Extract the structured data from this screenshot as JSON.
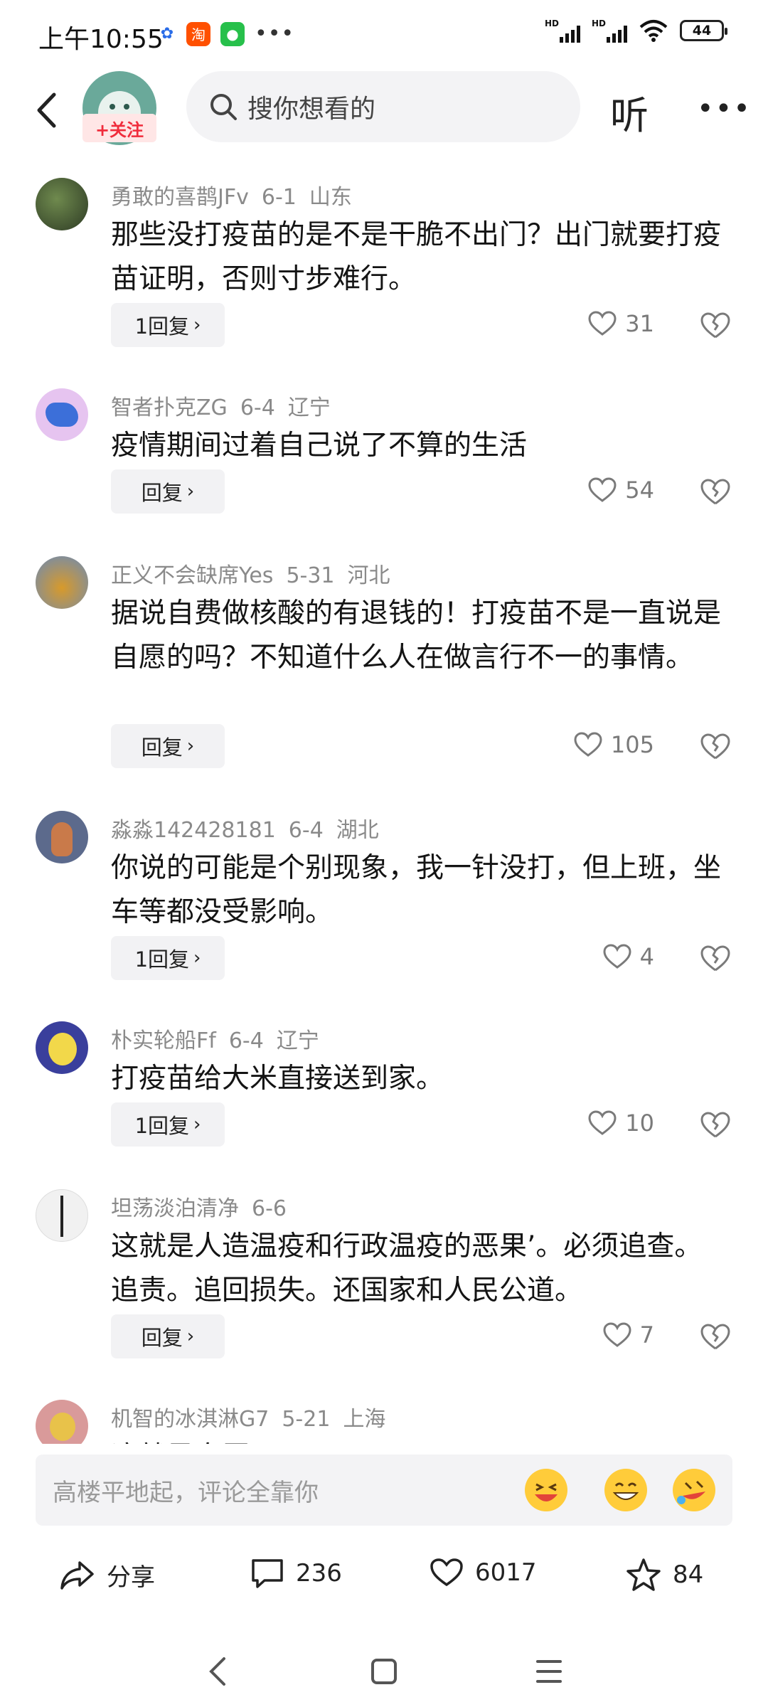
{
  "status_bar": {
    "time": "上午10:55",
    "battery": "44",
    "signal_label": "HD"
  },
  "header": {
    "follow_label": "+关注",
    "search_placeholder": "搜你想看的",
    "listen_label": "听"
  },
  "comments": [
    {
      "username": "勇敢的喜鹊JFv",
      "date": "6-1",
      "location": "山东",
      "text": "那些没打疫苗的是不是干脆不出门？出门就要打疫苗证明，否则寸步难行。",
      "reply_label": "1回复",
      "likes": "31"
    },
    {
      "username": "智者扑克ZG",
      "date": "6-4",
      "location": "辽宁",
      "text": "疫情期间过着自己说了不算的生活",
      "reply_label": "回复",
      "likes": "54"
    },
    {
      "username": "正义不会缺席Yes",
      "date": "5-31",
      "location": "河北",
      "text": "据说自费做核酸的有退钱的！打疫苗不是一直说是自愿的吗？不知道什么人在做言行不一的事情。",
      "reply_label": "回复",
      "likes": "105"
    },
    {
      "username": "淼淼142428181",
      "date": "6-4",
      "location": "湖北",
      "text": "你说的可能是个别现象，我一针没打，但上班，坐车等都没受影响。",
      "reply_label": "1回复",
      "likes": "4"
    },
    {
      "username": "朴实轮船Ff",
      "date": "6-4",
      "location": "辽宁",
      "text": "打疫苗给大米直接送到家。",
      "reply_label": "1回复",
      "likes": "10"
    },
    {
      "username": "坦荡淡泊清净",
      "date": "6-6",
      "location": "",
      "text": "这就是人造温疫和行政温疫的恶果’。必须追查。追责。追回损失。还国家和人民公道。",
      "reply_label": "回复",
      "likes": "7"
    },
    {
      "username": "机智的冰淇淋G7",
      "date": "5-21",
      "location": "上海",
      "text": "这就是自愿?",
      "reply_label": "",
      "likes": ""
    }
  ],
  "input": {
    "placeholder": "高楼平地起，评论全靠你"
  },
  "actions": {
    "share_label": "分享",
    "comments_count": "236",
    "likes_count": "6017",
    "favorites_count": "84"
  },
  "colors": {
    "accent_red": "#f02c3c",
    "meta_gray": "#8a8a8a"
  }
}
